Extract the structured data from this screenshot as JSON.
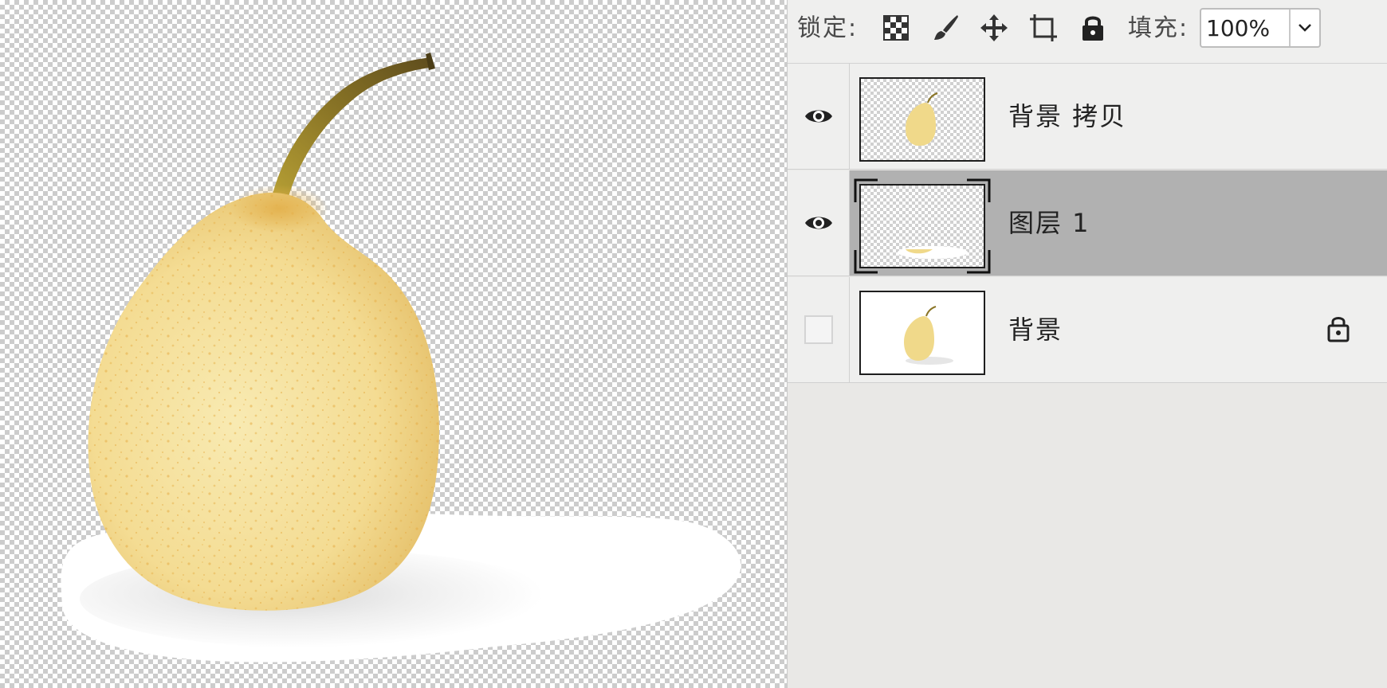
{
  "toolbar": {
    "lock_label": "锁定:",
    "fill_label": "填充:",
    "fill_value": "100%",
    "lock_icons": [
      "lock-transparent-pixels-icon",
      "lock-image-pixels-icon",
      "lock-position-icon",
      "lock-artboard-icon",
      "lock-all-icon"
    ]
  },
  "layers": [
    {
      "name": "背景 拷贝",
      "visible": true,
      "selected": false,
      "locked": false
    },
    {
      "name": "图层 1",
      "visible": true,
      "selected": true,
      "locked": false
    },
    {
      "name": "背景",
      "visible": false,
      "selected": false,
      "locked": true
    }
  ],
  "colors": {
    "pear": "#f3dd95",
    "pear_speckle": "#e8b44f",
    "stem": "#7a6a22",
    "selected_row": "#b1b1b1"
  }
}
